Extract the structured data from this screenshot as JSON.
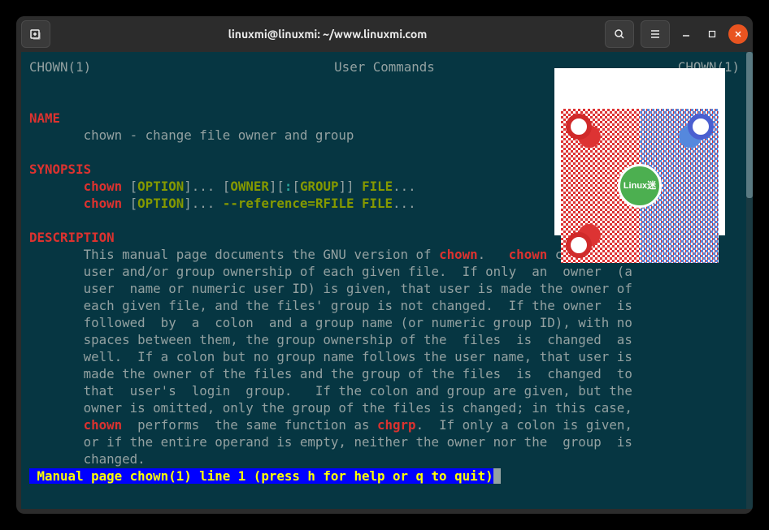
{
  "window": {
    "title": "linuxmi@linuxmi: ~/www.linuxmi.com"
  },
  "man": {
    "header_left": "CHOWN(1)",
    "header_center": "User Commands",
    "header_right": "CHOWN(1)",
    "section_name": "NAME",
    "name_line": "chown - change file owner and group",
    "section_synopsis": "SYNOPSIS",
    "syn1_cmd": "chown",
    "syn1_opt": "OPTION",
    "syn1_owner": "OWNER",
    "syn1_group": "GROUP",
    "syn1_file": "FILE",
    "syn2_cmd": "chown",
    "syn2_opt": "OPTION",
    "syn2_ref": "--reference=RFILE FILE",
    "section_desc": "DESCRIPTION",
    "desc_pre1": "This manual page documents the GNU version of ",
    "desc_chown1": "chown",
    "desc_mid1": ".   ",
    "desc_chown2": "chown",
    "desc_post1": " changes the",
    "desc_l2": "user and/or group ownership of each given file.  If only  an  owner  (a",
    "desc_l3": "user  name or numeric user ID) is given, that user is made the owner of",
    "desc_l4": "each given file, and the files' group is not changed.  If the owner  is",
    "desc_l5": "followed  by  a  colon  and a group name (or numeric group ID), with no",
    "desc_l6": "spaces between them, the group ownership of the  files  is  changed  as",
    "desc_l7": "well.  If a colon but no group name follows the user name, that user is",
    "desc_l8": "made the owner of the files and the group of the files  is  changed  to",
    "desc_l9": "that  user's  login  group.   If the colon and group are given, but the",
    "desc_l10": "owner is omitted, only the group of the files is changed; in this case,",
    "desc_l11a": "chown",
    "desc_l11b": "  performs  the same function as ",
    "desc_l11c": "chgrp",
    "desc_l11d": ".  If only a colon is given,",
    "desc_l12": "or if the entire operand is empty, neither the owner nor the  group  is",
    "desc_l13": "changed.",
    "status": " Manual page chown(1) line 1 (press h for help or q to quit)"
  },
  "qr": {
    "center_label": "Linux迷"
  }
}
